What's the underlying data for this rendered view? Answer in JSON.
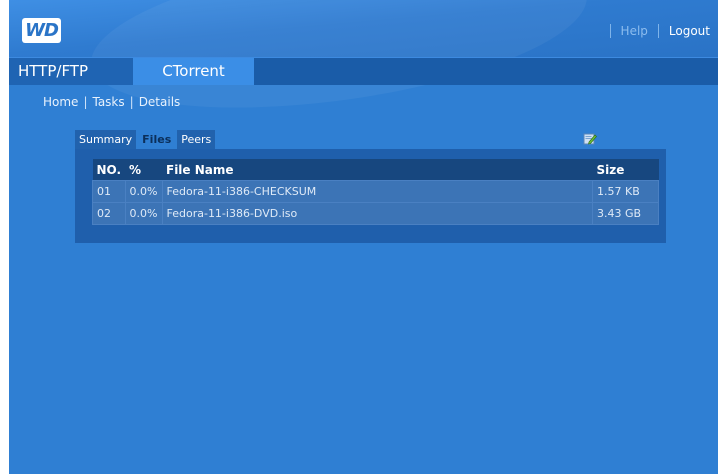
{
  "header": {
    "logo_text": "WD",
    "help_label": "Help",
    "logout_label": "Logout"
  },
  "nav": {
    "tabs": [
      {
        "label": "HTTP/FTP"
      },
      {
        "label": "CTorrent"
      }
    ]
  },
  "breadcrumb": {
    "items": [
      "Home",
      "Tasks",
      "Details"
    ],
    "separator": "|"
  },
  "detail_tabs": {
    "items": [
      {
        "label": "Summary"
      },
      {
        "label": "Files"
      },
      {
        "label": "Peers"
      }
    ],
    "active": "Files"
  },
  "files_table": {
    "columns": [
      "NO.",
      "%",
      "File Name",
      "Size"
    ],
    "rows": [
      {
        "no": "01",
        "pct": "0.0%",
        "name": "Fedora-11-i386-CHECKSUM",
        "size": "1.57 KB"
      },
      {
        "no": "02",
        "pct": "0.0%",
        "name": "Fedora-11-i386-DVD.iso",
        "size": "3.43 GB"
      }
    ]
  },
  "icons": {
    "edit": "edit-icon"
  },
  "colors": {
    "background": "#2f7fd3",
    "nav_active": "#3b8ee6",
    "panel": "#1f5fac",
    "table_header": "#17477f"
  }
}
